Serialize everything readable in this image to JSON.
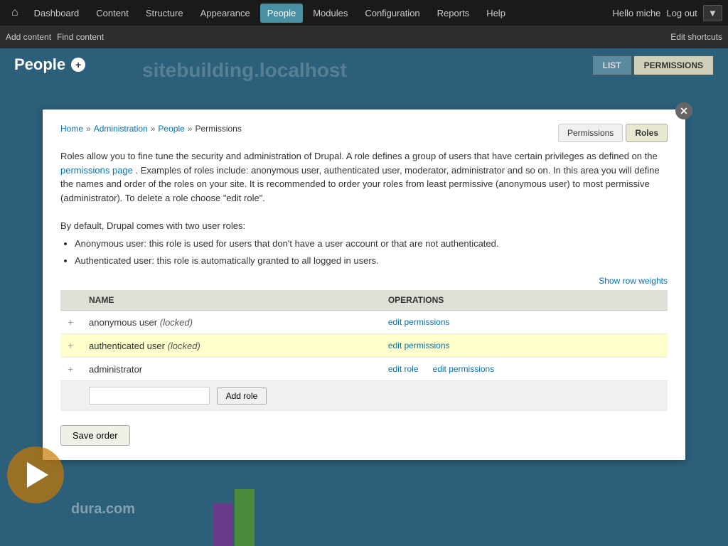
{
  "topnav": {
    "home_icon": "⌂",
    "items": [
      {
        "label": "Dashboard",
        "active": false
      },
      {
        "label": "Content",
        "active": false
      },
      {
        "label": "Structure",
        "active": false
      },
      {
        "label": "Appearance",
        "active": false
      },
      {
        "label": "People",
        "active": true
      },
      {
        "label": "Modules",
        "active": false
      },
      {
        "label": "Configuration",
        "active": false
      },
      {
        "label": "Reports",
        "active": false
      },
      {
        "label": "Help",
        "active": false
      }
    ],
    "hello": "Hello miche",
    "logout": "Log out",
    "dropdown_icon": "▼"
  },
  "secondary_toolbar": {
    "add_content": "Add content",
    "find_content": "Find content",
    "edit_shortcuts": "Edit shortcuts"
  },
  "page": {
    "title": "People",
    "add_icon": "+",
    "site_name": "sitebuilding.localhost",
    "tab_list": "LIST",
    "tab_permissions": "PERMISSIONS"
  },
  "breadcrumb": {
    "home": "Home",
    "admin": "Administration",
    "people": "People",
    "current": "Permissions"
  },
  "sub_tabs": {
    "permissions": "Permissions",
    "roles": "Roles"
  },
  "description": {
    "main": "Roles allow you to fine tune the security and administration of Drupal. A role defines a group of users that have certain privileges as defined on the",
    "permissions_link": "permissions page",
    "rest": ". Examples of roles include: anonymous user, authenticated user, moderator, administrator and so on. In this area you will define the names and order of the roles on your site. It is recommended to order your roles from least permissive (anonymous user) to most permissive (administrator). To delete a role choose \"edit role\".",
    "default_intro": "By default, Drupal comes with two user roles:",
    "bullet1": "Anonymous user: this role is used for users that don't have a user account or that are not authenticated.",
    "bullet2": "Authenticated user: this role is automatically granted to all logged in users."
  },
  "show_row_weights": "Show row weights",
  "table": {
    "col_name": "NAME",
    "col_operations": "OPERATIONS",
    "rows": [
      {
        "name": "anonymous user",
        "locked": "(locked)",
        "highlighted": false,
        "ops": [
          {
            "label": "edit permissions",
            "href": "#"
          }
        ]
      },
      {
        "name": "authenticated user",
        "locked": "(locked)",
        "highlighted": true,
        "ops": [
          {
            "label": "edit permissions",
            "href": "#"
          }
        ]
      },
      {
        "name": "administrator",
        "locked": "",
        "highlighted": false,
        "ops": [
          {
            "label": "edit role",
            "href": "#"
          },
          {
            "label": "edit permissions",
            "href": "#"
          }
        ]
      }
    ]
  },
  "add_role": {
    "placeholder": "",
    "button_label": "Add role"
  },
  "save_order": {
    "label": "Save order"
  },
  "bg": {
    "text": "dura.com"
  }
}
